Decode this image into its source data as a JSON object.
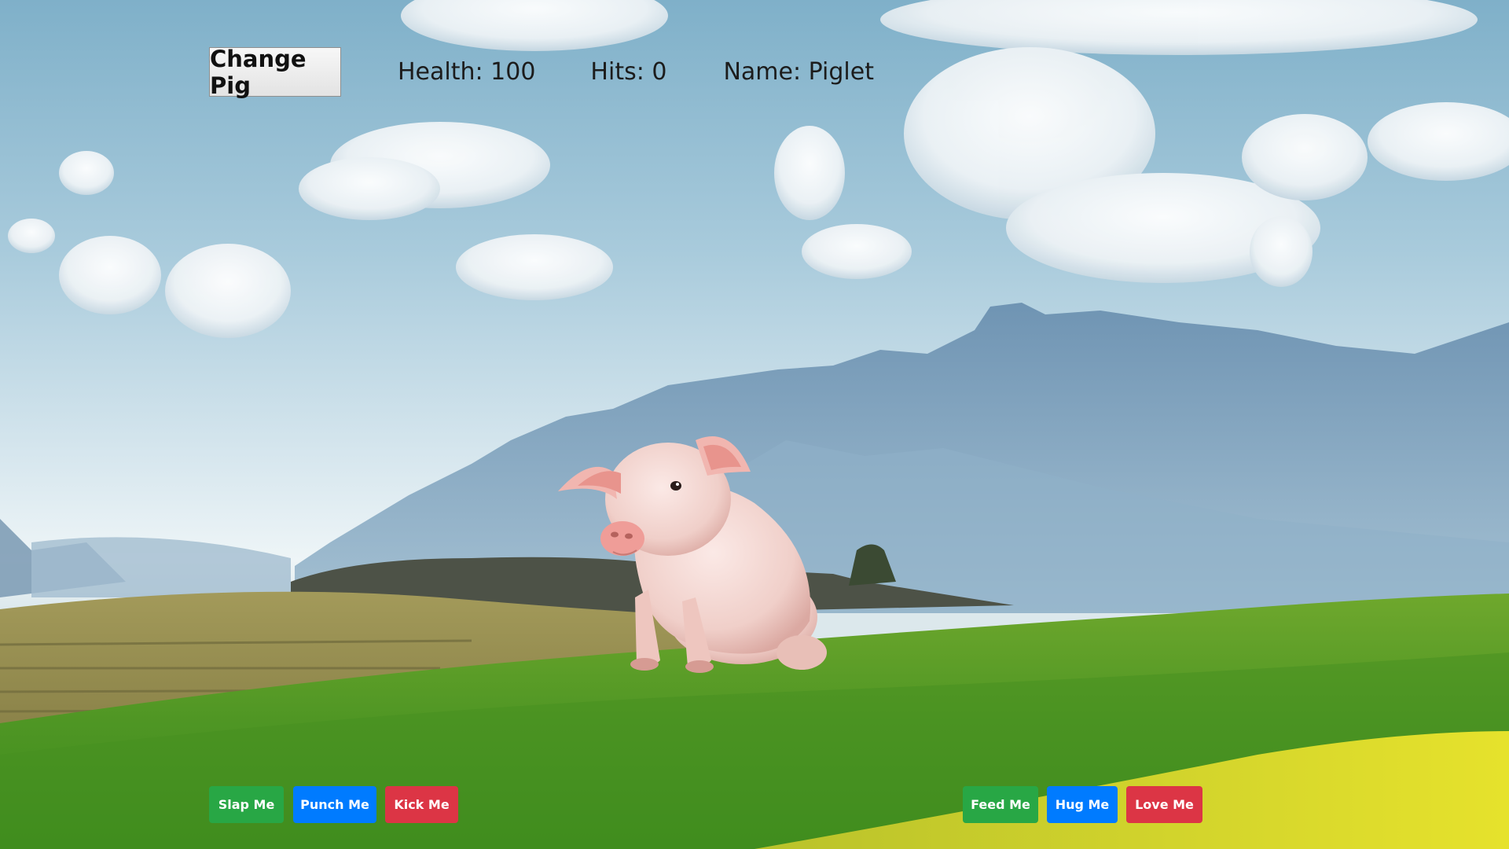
{
  "header": {
    "change_pig_label": "Change Pig",
    "health_text": "Health: 100",
    "hits_text": "Hits: 0",
    "name_text": "Name: Piglet"
  },
  "actions_left": {
    "slap_label": "Slap Me",
    "punch_label": "Punch Me",
    "kick_label": "Kick Me"
  },
  "actions_right": {
    "feed_label": "Feed Me",
    "hug_label": "Hug Me",
    "love_label": "Love Me"
  },
  "colors": {
    "green": "#28a745",
    "blue": "#007bff",
    "red": "#dc3545"
  }
}
